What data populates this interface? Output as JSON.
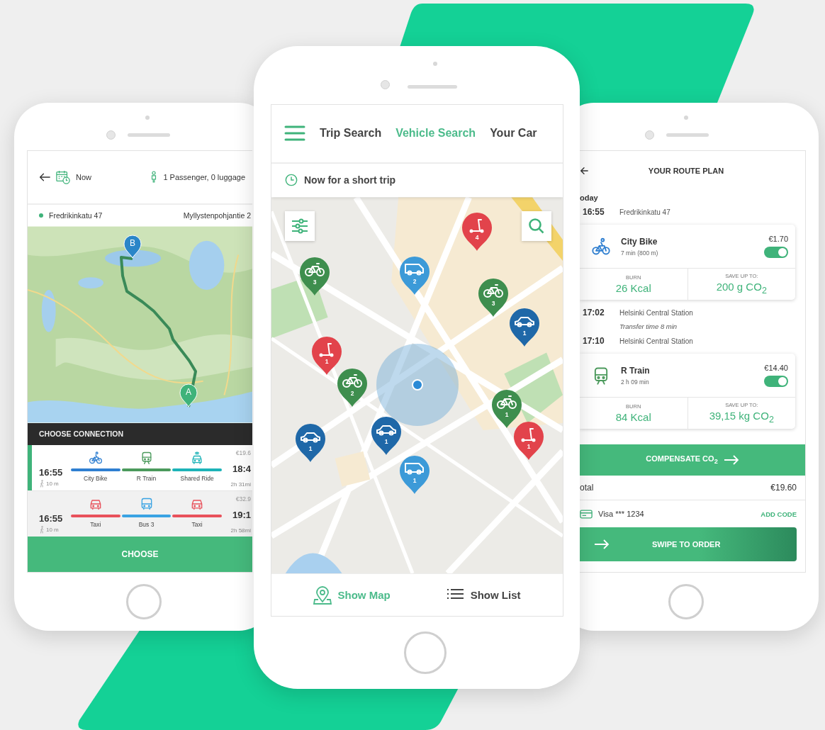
{
  "trip_planner": {
    "header": {
      "time": "Now",
      "passengers": "1 Passenger, 0 luggage"
    },
    "from": "Fredrikinkatu 47",
    "to": "Myllystenpohjantie 2",
    "map": {
      "kind": "picture",
      "pins": [
        {
          "label": "B",
          "color": "#2a86c8"
        },
        {
          "label": "A",
          "color": "#3fb37a"
        }
      ]
    },
    "connections_title": "CHOOSE CONNECTION",
    "connections": [
      {
        "selected": true,
        "depart": "16:55",
        "walk": "10 m",
        "price": "€19.6",
        "arrive": "18:4",
        "duration": "2h 31mi",
        "legs": [
          {
            "kind": "bike",
            "label": "City Bike",
            "color": "#2f7fd1"
          },
          {
            "kind": "train",
            "label": "R Train",
            "color": "#4b9a5c"
          },
          {
            "kind": "shared",
            "label": "Shared Ride",
            "color": "#1db3b8"
          }
        ]
      },
      {
        "selected": false,
        "depart": "16:55",
        "walk": "10 m",
        "price": "€32.9",
        "arrive": "19:1",
        "duration": "2h 58mi",
        "legs": [
          {
            "kind": "taxi",
            "label": "Taxi",
            "color": "#e8515b"
          },
          {
            "kind": "bus",
            "label": "Bus 3",
            "color": "#3aa3e3"
          },
          {
            "kind": "taxi",
            "label": "Taxi",
            "color": "#e8515b"
          }
        ]
      }
    ],
    "choose_button": "CHOOSE"
  },
  "vehicle_search": {
    "tabs": [
      {
        "label": "Trip Search",
        "selected": false
      },
      {
        "label": "Vehicle Search",
        "selected": true
      },
      {
        "label": "Your Car",
        "selected": false
      }
    ],
    "time_filter": "Now for a short trip",
    "markers": [
      {
        "kind": "scooter",
        "count": "4",
        "color": "#e2434b"
      },
      {
        "kind": "bike",
        "count": "3",
        "color": "#3e8e4e"
      },
      {
        "kind": "van",
        "count": "2",
        "color": "#3c9ad8"
      },
      {
        "kind": "bike",
        "count": "3",
        "color": "#3e8e4e"
      },
      {
        "kind": "car",
        "count": "1",
        "color": "#1f68a8"
      },
      {
        "kind": "scooter",
        "count": "1",
        "color": "#e2434b"
      },
      {
        "kind": "bike",
        "count": "2",
        "color": "#3e8e4e"
      },
      {
        "kind": "bike",
        "count": "1",
        "color": "#3e8e4e"
      },
      {
        "kind": "scooter",
        "count": "1",
        "color": "#e2434b"
      },
      {
        "kind": "car",
        "count": "1",
        "color": "#1f68a8"
      },
      {
        "kind": "car",
        "count": "1",
        "color": "#1f68a8"
      },
      {
        "kind": "van",
        "count": "1",
        "color": "#3c9ad8"
      }
    ],
    "view_toggle": [
      {
        "kind": "map",
        "label": "Show Map",
        "selected": true
      },
      {
        "kind": "list",
        "label": "Show List",
        "selected": false
      }
    ]
  },
  "route_plan": {
    "title": "YOUR ROUTE PLAN",
    "day": "oday",
    "timeline": [
      {
        "kind": "stop",
        "time": "16:55",
        "place": "Fredrikinkatu 47"
      },
      {
        "kind": "leg",
        "transport": {
          "kind": "bike",
          "color": "#2f7fd1"
        },
        "name": "City Bike",
        "detail": "7 min (800 m)",
        "price": "€1.70",
        "on": true,
        "burn_label": "BURN",
        "burn": "26 Kcal",
        "save_label": "SAVE UP TO:",
        "save": "200 g CO$_{2}$"
      },
      {
        "kind": "stop",
        "time": "17:02",
        "place": "Helsinki Central Station"
      },
      {
        "kind": "note",
        "text": "Transfer time 8 min"
      },
      {
        "kind": "stop",
        "time": "17:10",
        "place": "Helsinki Central Station"
      },
      {
        "kind": "leg",
        "transport": {
          "kind": "train",
          "color": "#4b9a5c"
        },
        "name": "R Train",
        "detail": "2 h 09 min",
        "price": "€14.40",
        "on": true,
        "burn_label": "BURN",
        "burn": "84 Kcal",
        "save_label": "SAVE UP TO:",
        "save": "39,15 kg CO$_{2}$"
      }
    ],
    "compensate_button": "COMPENSATE CO$_{2}$",
    "total_label": "otal",
    "total": "€19.60",
    "payment": "Visa *** 1234",
    "add_code": "ADD CODE",
    "order_button": "SWIPE TO ORDER"
  }
}
